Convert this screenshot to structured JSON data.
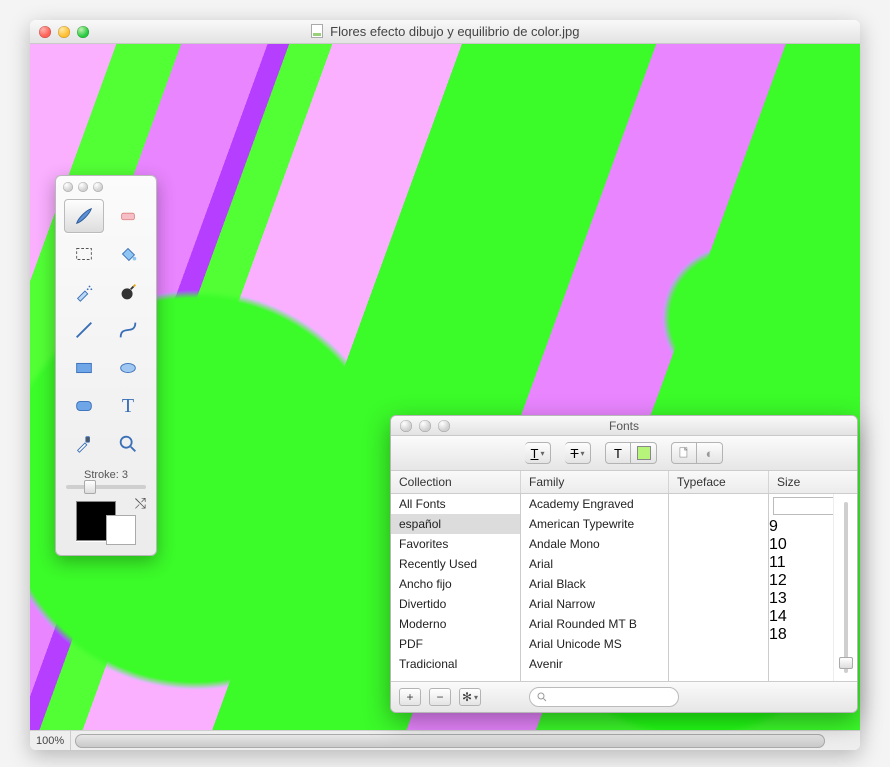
{
  "window": {
    "title": "Flores efecto dibujo y equilibrio de color.jpg",
    "zoom": "100%"
  },
  "tools": {
    "stroke_label": "Stroke: 3",
    "stroke_value_percent": 22,
    "items": [
      {
        "name": "brush-tool",
        "selected": true
      },
      {
        "name": "eraser-tool",
        "selected": false
      },
      {
        "name": "marquee-tool",
        "selected": false
      },
      {
        "name": "paint-bucket-tool",
        "selected": false
      },
      {
        "name": "airbrush-tool",
        "selected": false
      },
      {
        "name": "bomb-tool",
        "selected": false
      },
      {
        "name": "line-tool",
        "selected": false
      },
      {
        "name": "curve-tool",
        "selected": false
      },
      {
        "name": "rectangle-tool",
        "selected": false
      },
      {
        "name": "ellipse-tool",
        "selected": false
      },
      {
        "name": "rounded-rect-tool",
        "selected": false
      },
      {
        "name": "text-tool",
        "selected": false
      },
      {
        "name": "eyedropper-tool",
        "selected": false
      },
      {
        "name": "zoom-tool",
        "selected": false
      }
    ],
    "swatches": {
      "foreground": "#000000",
      "background": "#ffffff"
    }
  },
  "fonts": {
    "title": "Fonts",
    "columns": {
      "collection": "Collection",
      "family": "Family",
      "typeface": "Typeface",
      "size": "Size"
    },
    "collections": [
      "All Fonts",
      "español",
      "Favorites",
      "Recently Used",
      "Ancho fijo",
      "Divertido",
      "Moderno",
      "PDF",
      "Tradicional"
    ],
    "collections_selected": "español",
    "families": [
      "Academy Engraved",
      "American Typewrite",
      "Andale Mono",
      "Arial",
      "Arial Black",
      "Arial Narrow",
      "Arial Rounded MT B",
      "Arial Unicode MS",
      "Avenir"
    ],
    "typefaces": [],
    "sizes": [
      "9",
      "10",
      "11",
      "12",
      "13",
      "14",
      "18"
    ],
    "size_input": "",
    "search_placeholder": "",
    "toolbar": {
      "underline_label": "T",
      "strike_label": "T",
      "text_tool_label": "T"
    }
  }
}
